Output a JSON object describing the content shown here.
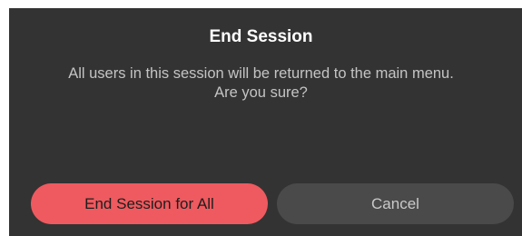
{
  "dialog": {
    "title": "End Session",
    "message_line1": "All users in this session will be returned to the main menu.",
    "message_line2": "Are you sure?",
    "confirm_label": "End Session for All",
    "cancel_label": "Cancel"
  },
  "colors": {
    "dialog_background": "#333333",
    "confirm_button": "#ee5a5f",
    "cancel_button": "#4a4a4a"
  }
}
